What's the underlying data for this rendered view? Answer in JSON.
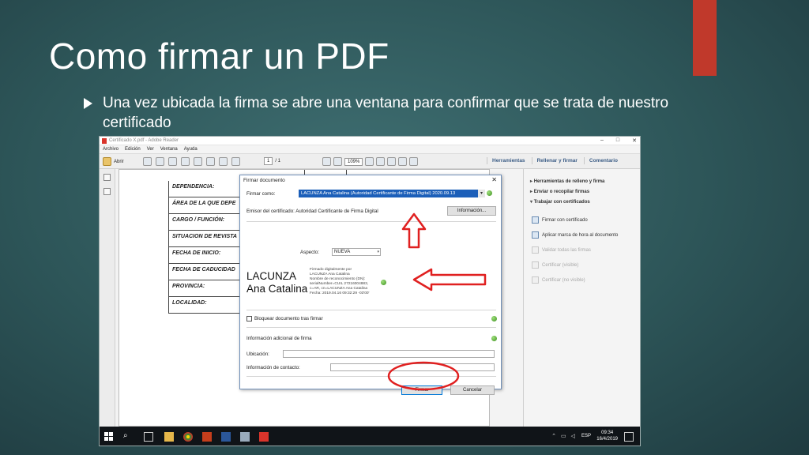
{
  "slide": {
    "title": "Como firmar un PDF",
    "bullet": "Una vez ubicada la firma se abre una ventana para confirmar que se trata de nuestro certificado",
    "accent_color": "#c0392b"
  },
  "app": {
    "window_title": "Certificado X.pdf - Adobe Reader",
    "menu": [
      "Archivo",
      "Edición",
      "Ver",
      "Ventana",
      "Ayuda"
    ],
    "toolbar": {
      "open_label": "Abrir",
      "page_current": "1",
      "page_total": "/ 1",
      "zoom": "109%",
      "tabs": [
        "Herramientas",
        "Rellenar y firmar",
        "Comentario"
      ]
    }
  },
  "document": {
    "fields": [
      "DEPENDENCIA:",
      "ÁREA DE LA QUE DEPE",
      "CARGO / FUNCIÓN:",
      "SITUACION DE REVISTA",
      "FECHA DE INICIO:",
      "FECHA DE CADUCIDAD",
      "PROVINCIA:",
      "LOCALIDAD:"
    ]
  },
  "right_panel": {
    "sections": [
      "Herramientas de relleno y firma",
      "Enviar o recopilar firmas",
      "Trabajar con certificados"
    ],
    "items": [
      {
        "label": "Firmar con certificado",
        "enabled": true
      },
      {
        "label": "Aplicar marca de hora al documento",
        "enabled": true
      },
      {
        "label": "Validar todas las firmas",
        "enabled": false
      },
      {
        "label": "Certificar (visible)",
        "enabled": false
      },
      {
        "label": "Certificar (no visible)",
        "enabled": false
      }
    ]
  },
  "dialog": {
    "title": "Firmar documento",
    "sign_as_label": "Firmar como:",
    "sign_as_value": "LACUNZA Ana Catalina (Autoridad Certificante de Firma Digital) 2020.09.13",
    "issuer": "Emisor del certificado: Autoridad Certificante de Firma Digital",
    "info_button": "Información...",
    "appearance_label": "Aspecto:",
    "appearance_value": "NUEVA",
    "signature_name_line1": "LACUNZA",
    "signature_name_line2": "Ana Catalina",
    "signature_meta": [
      "Firmado digitalmente por",
      "LACUNZA Ana Catalina",
      "Nombre de reconocimiento (DN):",
      "serialNumber=CUIL 27216004883,",
      "c=AR, cn=LACUNZA Ana Catalina",
      "Fecha: 2019.04.16 09:32:29 -03'00'"
    ],
    "lock_label": "Bloquear documento tras firmar",
    "additional_info": "Información adicional de firma",
    "location_label": "Ubicación:",
    "contact_label": "Información de contacto:",
    "sign_button": "Firmar",
    "cancel_button": "Cancelar",
    "annotation_color": "#e02020"
  },
  "taskbar": {
    "language": "ESP",
    "time": "09:34",
    "date": "16/4/2019"
  }
}
